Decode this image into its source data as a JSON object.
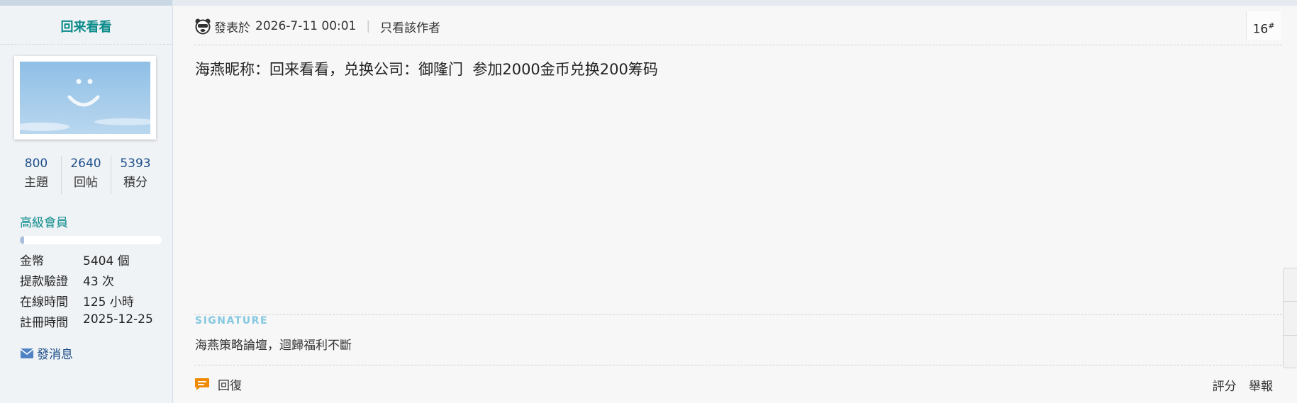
{
  "user": {
    "name": "回来看看",
    "stats": [
      {
        "value": "800",
        "label": "主題"
      },
      {
        "value": "2640",
        "label": "回帖"
      },
      {
        "value": "5393",
        "label": "積分"
      }
    ],
    "level": "高級會員",
    "level_progress": 0.03,
    "info": [
      {
        "key": "金幣",
        "value": "5404 個"
      },
      {
        "key": "提款驗證",
        "value": "43 次"
      },
      {
        "key": "在線時間",
        "value": "125 小時"
      },
      {
        "key": "註冊時間",
        "value": "2025-12-25"
      }
    ],
    "send_message": "發消息"
  },
  "post": {
    "posted_prefix": "發表於",
    "posted_time": "2026-7-11 00:01",
    "separator": "|",
    "only_author": "只看該作者",
    "floor_number": "16",
    "floor_mark": "#",
    "body": "海燕昵称：回来看看，兑换公司：御隆门  参加2000金币兑换200筹码",
    "signature_label": "SIGNATURE",
    "signature_text": "海燕策略論壇，迴歸福利不斷",
    "reply_label": "回復",
    "rate_label": "評分",
    "report_label": "舉報"
  },
  "colors": {
    "username": "#0c8b8b",
    "link": "#1d4f8a",
    "signature_label": "#84c8e0",
    "reply_icon": "#f08a00"
  },
  "icons": {
    "avatar": "sky-smiley-avatar",
    "poster": "bear-face-icon",
    "message": "envelope-icon",
    "reply": "speech-bubble-icon"
  }
}
